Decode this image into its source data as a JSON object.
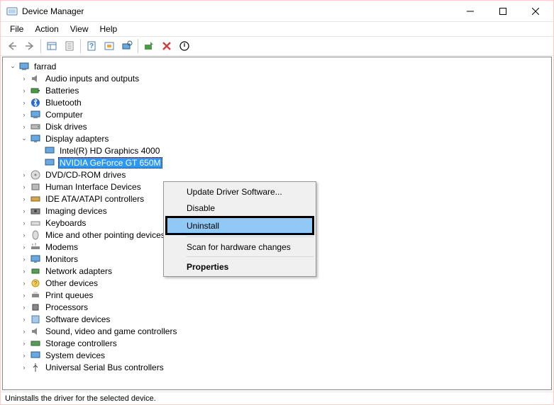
{
  "window": {
    "title": "Device Manager"
  },
  "menu": {
    "file": "File",
    "action": "Action",
    "view": "View",
    "help": "Help"
  },
  "tree": {
    "root": "farrad",
    "items": [
      "Audio inputs and outputs",
      "Batteries",
      "Bluetooth",
      "Computer",
      "Disk drives",
      "Display adapters",
      "DVD/CD-ROM drives",
      "Human Interface Devices",
      "IDE ATA/ATAPI controllers",
      "Imaging devices",
      "Keyboards",
      "Mice and other pointing devices",
      "Modems",
      "Monitors",
      "Network adapters",
      "Other devices",
      "Print queues",
      "Processors",
      "Software devices",
      "Sound, video and game controllers",
      "Storage controllers",
      "System devices",
      "Universal Serial Bus controllers"
    ],
    "display_children": [
      "Intel(R) HD Graphics 4000",
      "NVIDIA GeForce GT 650M"
    ]
  },
  "context": {
    "update": "Update Driver Software...",
    "disable": "Disable",
    "uninstall": "Uninstall",
    "scan": "Scan for hardware changes",
    "properties": "Properties"
  },
  "status": "Uninstalls the driver for the selected device."
}
